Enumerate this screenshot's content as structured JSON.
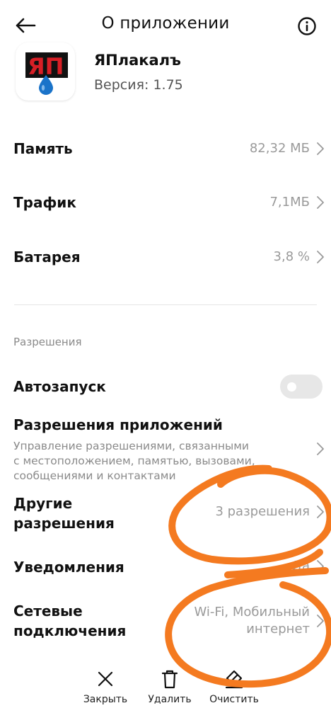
{
  "header": {
    "title": "О приложении",
    "back_icon": "arrow-left-icon",
    "info_icon": "info-circle-icon"
  },
  "app": {
    "name": "ЯПлакалъ",
    "version": "Версия: 1.75",
    "icon_letters": "ЯП",
    "icon_colors": {
      "letters": "#d81f26",
      "box": "#111111",
      "drop": "#1a73c9"
    }
  },
  "storage_rows": [
    {
      "label": "Память",
      "value": "82,32 МБ"
    },
    {
      "label": "Трафик",
      "value": "7,1МБ"
    },
    {
      "label": "Батарея",
      "value": "3,8 %"
    }
  ],
  "permissions": {
    "section_title": "Разрешения",
    "autostart": {
      "label": "Автозапуск",
      "enabled": false
    },
    "app_permissions": {
      "label": "Разрешения приложений",
      "description_lines": [
        "Управление разрешениями, связанными",
        "с местоположением, памятью, вызовами,",
        "сообщениями и контактами"
      ]
    },
    "other": {
      "label_lines": [
        "Другие",
        "разрешения"
      ],
      "value": "3 разрешения"
    },
    "notifications": {
      "label": "Уведомления",
      "value": "Да"
    },
    "network": {
      "label_lines": [
        "Сетевые",
        "подключения"
      ],
      "value_lines": [
        "Wi-Fi, Мобильный",
        "интернет"
      ]
    }
  },
  "bottom_actions": [
    {
      "label": "Закрыть",
      "icon": "close-icon"
    },
    {
      "label": "Удалить",
      "icon": "trash-icon"
    },
    {
      "label": "Очистить",
      "icon": "eraser-icon"
    }
  ],
  "colors": {
    "annotation": "#f47a20",
    "text_primary": "#111111",
    "text_secondary": "#9a9a9a"
  }
}
